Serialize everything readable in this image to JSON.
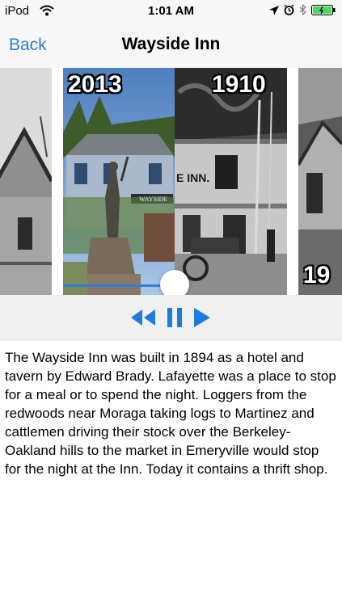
{
  "status_bar": {
    "carrier": "iPod",
    "time": "1:01 AM"
  },
  "nav": {
    "back_label": "Back",
    "title": "Wayside Inn"
  },
  "carousel": {
    "photos": [
      {
        "year": ""
      },
      {
        "year": "2013",
        "sign_text": "WAYSIDE"
      },
      {
        "year": "1910",
        "sign_text": "E INN."
      },
      {
        "year": "19"
      }
    ],
    "slider_progress": 0.5
  },
  "controls": {
    "icons": [
      "rewind-icon",
      "pause-icon",
      "play-icon"
    ],
    "accent_color": "#1e7be0"
  },
  "description": "The Wayside Inn was built in 1894 as a hotel and tavern by Edward Brady.  Lafayette was a place to stop for a meal or to spend the night.  Loggers from the redwoods near Moraga taking logs to Martinez and cattlemen driving their stock over the Berkeley-Oakland hills to the market in Emeryville would stop for the night at the Inn.  Today it contains a thrift shop."
}
